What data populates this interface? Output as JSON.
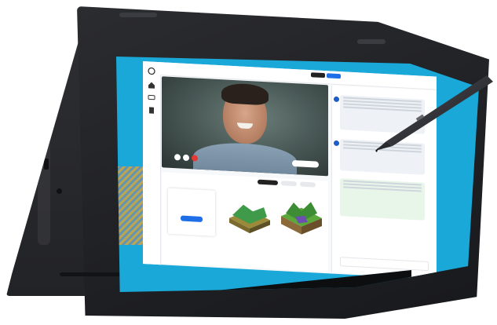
{
  "app": {
    "title": "",
    "header_buttons": [
      "",
      ""
    ],
    "panel_title": "",
    "lesson_button": "",
    "materials_title": "",
    "tabs": [
      "",
      "",
      ""
    ],
    "card_title": "",
    "card_button": "",
    "chat_input_placeholder": ""
  },
  "taskbar": {
    "start_icon": "windows-icon",
    "back_icon": "back-arrow-icon",
    "home_icon": "circle-home-icon",
    "task_icon": "task-view-icon"
  },
  "colors": {
    "screen_edge": "#1aa8d8",
    "accent_blue": "#1e6ee8",
    "end_call_red": "#e53935",
    "device_body": "#1f2024"
  }
}
